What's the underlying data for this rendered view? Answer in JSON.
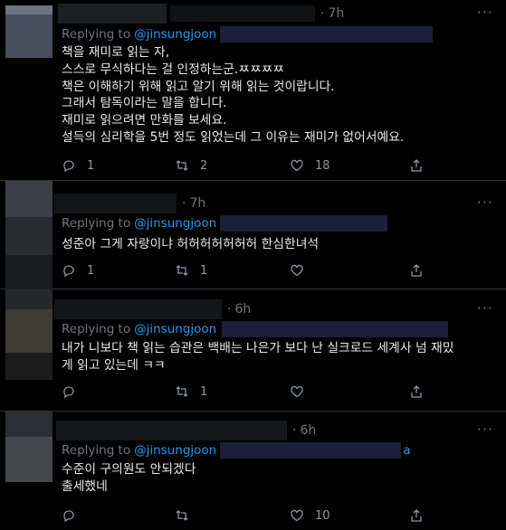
{
  "colors": {
    "background": "#000000",
    "text": "#e7e9ea",
    "muted": "#6e767d",
    "link": "#1d9bf0",
    "divider": "#2f3336"
  },
  "tweets": [
    {
      "time": "7h",
      "replying_label": "Replying to",
      "handle": "@jinsungjoon",
      "handle_suffix": "",
      "lines": [
        "책을 재미로 읽는 자,",
        "스스로 무식하다는 걸 인정하는군.ㅉㅉㅉㅉ",
        "책은 이해하기 위해 읽고 알기 위해 읽는 것이랍니다.",
        "그래서 탐독이라는 말을 합니다.",
        "재미로 읽으려면 만화를 보세요.",
        "설득의 심리학을 5번 정도 읽었는데 그 이유는 재미가 없어서예요."
      ],
      "reply_count": "1",
      "retweet_count": "2",
      "like_count": "18",
      "share_icon": "share-icon"
    },
    {
      "time": "7h",
      "replying_label": "Replying to",
      "handle": "@jinsungjoon",
      "handle_suffix": "",
      "lines": [
        "성준아 그게 자랑이냐 허허허허허허허 한심한녀석"
      ],
      "reply_count": "1",
      "retweet_count": "1",
      "like_count": "",
      "share_icon": "share-icon"
    },
    {
      "time": "6h",
      "replying_label": "Replying to",
      "handle": "@jinsungjoon",
      "handle_suffix": "",
      "lines": [
        "내가 니보다 책 읽는 습관은 백배는 나은가 보다 난 실크로드 세계사 넘 재밌",
        "게 읽고 있는데 ㅋㅋ"
      ],
      "reply_count": "",
      "retweet_count": "1",
      "like_count": "",
      "share_icon": "share-icon"
    },
    {
      "time": "6h",
      "replying_label": "Replying to",
      "handle": "@jinsungjoon",
      "handle_suffix": "a",
      "lines": [
        "수준이 구의원도 안되겠다",
        "출세했네"
      ],
      "reply_count": "",
      "retweet_count": "",
      "like_count": "10",
      "share_icon": "share-icon"
    }
  ]
}
